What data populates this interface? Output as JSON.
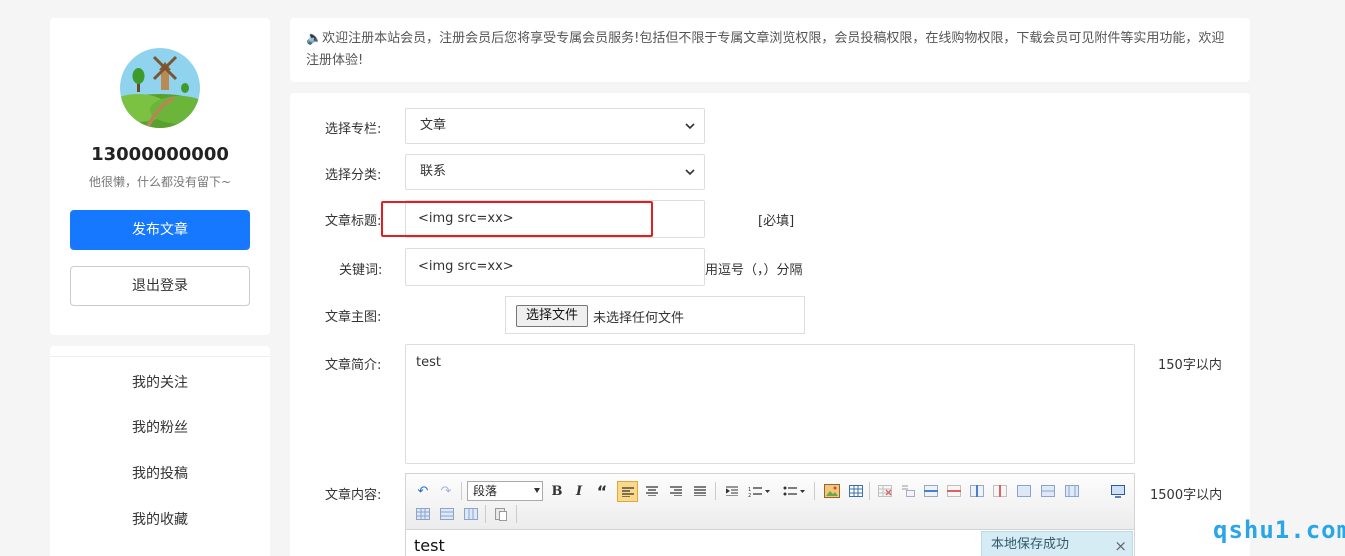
{
  "profile": {
    "username": "13000000000",
    "bio": "他很懒，什么都没有留下~",
    "publish_label": "发布文章",
    "logout_label": "退出登录"
  },
  "menu": {
    "items": [
      "我的关注",
      "我的粉丝",
      "我的投稿",
      "我的收藏"
    ]
  },
  "notice": {
    "icon": "speaker-icon",
    "text": "🔈欢迎注册本站会员，注册会员后您将享受专属会员服务!包括但不限于专属文章浏览权限，会员投稿权限，在线购物权限，下载会员可见附件等实用功能，欢迎注册体验!"
  },
  "form": {
    "column_label": "选择专栏:",
    "column_value": "文章",
    "category_label": "选择分类:",
    "category_value": "联系",
    "title_label": "文章标题:",
    "title_value": "<img src=xx>",
    "title_hint": "[必填]",
    "keywords_label": "关键词:",
    "keywords_value": "<img src=xx>",
    "keywords_hint": "用逗号（，）分隔",
    "image_label": "文章主图:",
    "file_button": "选择文件",
    "file_status": "未选择任何文件",
    "summary_label": "文章简介:",
    "summary_value": "test",
    "summary_hint": "150字以内",
    "content_label": "文章内容:",
    "content_hint": "1500字以内"
  },
  "editor": {
    "paragraph_value": "段落",
    "body_text": "test",
    "toast": "本地保存成功",
    "toast_close": "×"
  },
  "watermark": "qshu1.com",
  "colors": {
    "primary": "#1677ff",
    "highlight": "#e02020",
    "watermark": "#2aa6e8"
  }
}
